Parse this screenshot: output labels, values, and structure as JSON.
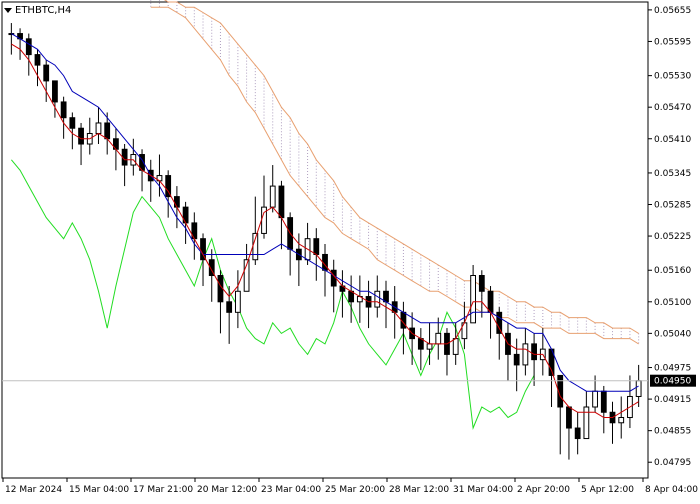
{
  "symbol_label": "ETHBTC,H4",
  "chart_data": {
    "type": "line",
    "title": "ETHBTC,H4",
    "ylim": [
      0.04765,
      0.0567
    ],
    "y_ticks": [
      "0.05655",
      "0.05595",
      "0.05530",
      "0.05470",
      "0.05410",
      "0.05345",
      "0.05285",
      "0.05225",
      "0.05160",
      "0.05100",
      "0.05040",
      "0.04975",
      "0.04915",
      "0.04855",
      "0.04795"
    ],
    "x_ticks": [
      "12 Mar 2024",
      "15 Mar 04:00",
      "17 Mar 21:00",
      "20 Mar 12:00",
      "23 Mar 04:00",
      "25 Mar 20:00",
      "28 Mar 12:00",
      "31 Mar 04:00",
      "2 Apr 20:00",
      "5 Apr 12:00",
      "8 Apr 04:00"
    ],
    "current_price": "0.04950",
    "colors": {
      "bull": "#000000",
      "bear": "#000000",
      "tenkan": "#cc0000",
      "kijun": "#0000b8",
      "chikou": "#22dd22",
      "kumo_up": "#e8a070",
      "kumo_down": "#b0a0c0",
      "grid": "#c0c0c0"
    },
    "close": [
      0.0561,
      0.056,
      0.0557,
      0.0555,
      0.0552,
      0.0548,
      0.0545,
      0.0543,
      0.054,
      0.0542,
      0.0544,
      0.0541,
      0.0539,
      0.0536,
      0.0538,
      0.0535,
      0.0533,
      0.0534,
      0.053,
      0.0528,
      0.0525,
      0.0522,
      0.0518,
      0.0515,
      0.051,
      0.0508,
      0.0512,
      0.0518,
      0.0523,
      0.0528,
      0.0532,
      0.0526,
      0.052,
      0.0518,
      0.0522,
      0.0519,
      0.0516,
      0.0513,
      0.0512,
      0.051,
      0.0511,
      0.0509,
      0.0512,
      0.051,
      0.0508,
      0.0505,
      0.0503,
      0.0501,
      0.0502,
      0.0504,
      0.05,
      0.0503,
      0.0506,
      0.0515,
      0.0512,
      0.0508,
      0.0504,
      0.05,
      0.0498,
      0.0502,
      0.0499,
      0.0501,
      0.0496,
      0.049,
      0.0486,
      0.0484,
      0.049,
      0.0493,
      0.0489,
      0.0487,
      0.0488,
      0.0492,
      0.0495
    ],
    "high": [
      0.0563,
      0.0562,
      0.0561,
      0.0558,
      0.0556,
      0.0552,
      0.0549,
      0.0546,
      0.0544,
      0.0545,
      0.0547,
      0.0546,
      0.0543,
      0.054,
      0.0541,
      0.0539,
      0.0537,
      0.0538,
      0.0535,
      0.0532,
      0.0529,
      0.0527,
      0.0523,
      0.052,
      0.0516,
      0.0513,
      0.0516,
      0.0521,
      0.053,
      0.0534,
      0.0536,
      0.0533,
      0.0527,
      0.0523,
      0.0525,
      0.0524,
      0.0521,
      0.0518,
      0.0516,
      0.0515,
      0.0515,
      0.0514,
      0.0515,
      0.0514,
      0.0513,
      0.051,
      0.0508,
      0.0505,
      0.0506,
      0.0507,
      0.0505,
      0.0506,
      0.051,
      0.0517,
      0.0516,
      0.0513,
      0.0509,
      0.0506,
      0.0503,
      0.0505,
      0.0504,
      0.0505,
      0.0501,
      0.0496,
      0.049,
      0.0489,
      0.0493,
      0.0496,
      0.0494,
      0.0491,
      0.0492,
      0.0496,
      0.0498
    ],
    "low": [
      0.0557,
      0.0556,
      0.0553,
      0.0551,
      0.0548,
      0.0545,
      0.0541,
      0.0539,
      0.0536,
      0.0538,
      0.054,
      0.0538,
      0.0535,
      0.0532,
      0.0534,
      0.0531,
      0.0529,
      0.053,
      0.0526,
      0.0524,
      0.0521,
      0.0518,
      0.0513,
      0.051,
      0.0504,
      0.0502,
      0.0505,
      0.0512,
      0.0517,
      0.0522,
      0.0527,
      0.052,
      0.0515,
      0.0513,
      0.0517,
      0.0514,
      0.0511,
      0.0508,
      0.0507,
      0.0506,
      0.0506,
      0.0505,
      0.0507,
      0.0505,
      0.0503,
      0.05,
      0.0498,
      0.0497,
      0.0498,
      0.0499,
      0.0496,
      0.0498,
      0.0501,
      0.0509,
      0.0507,
      0.0503,
      0.0499,
      0.0495,
      0.0493,
      0.0496,
      0.0494,
      0.0496,
      0.049,
      0.0481,
      0.048,
      0.0481,
      0.0485,
      0.0489,
      0.0485,
      0.0483,
      0.0484,
      0.0486,
      0.049
    ],
    "tenkan": [
      0.0559,
      0.0558,
      0.0556,
      0.0553,
      0.055,
      0.0547,
      0.0544,
      0.0542,
      0.0541,
      0.0541,
      0.0542,
      0.0541,
      0.0539,
      0.0537,
      0.0537,
      0.0535,
      0.0534,
      0.0533,
      0.0531,
      0.0528,
      0.0525,
      0.0522,
      0.0519,
      0.0516,
      0.0513,
      0.0511,
      0.0513,
      0.0517,
      0.0522,
      0.0527,
      0.0528,
      0.0526,
      0.0523,
      0.0521,
      0.052,
      0.0519,
      0.0517,
      0.0515,
      0.0513,
      0.0512,
      0.0511,
      0.051,
      0.051,
      0.0509,
      0.0508,
      0.0506,
      0.0504,
      0.0503,
      0.0502,
      0.0502,
      0.0502,
      0.0503,
      0.0506,
      0.051,
      0.051,
      0.0508,
      0.0505,
      0.0502,
      0.0501,
      0.0501,
      0.05,
      0.05,
      0.0497,
      0.0492,
      0.049,
      0.0489,
      0.0489,
      0.0489,
      0.0488,
      0.0488,
      0.0489,
      0.049,
      0.0491
    ],
    "kijun": [
      0.0561,
      0.056,
      0.0559,
      0.0558,
      0.0556,
      0.0555,
      0.0553,
      0.055,
      0.0549,
      0.0548,
      0.0547,
      0.0545,
      0.0543,
      0.0541,
      0.0539,
      0.0537,
      0.0534,
      0.0532,
      0.0529,
      0.0526,
      0.0524,
      0.0521,
      0.0519,
      0.0519,
      0.0519,
      0.0519,
      0.0519,
      0.0519,
      0.0519,
      0.0519,
      0.052,
      0.0521,
      0.052,
      0.0519,
      0.0518,
      0.0517,
      0.0516,
      0.0515,
      0.0514,
      0.0513,
      0.0512,
      0.0512,
      0.0511,
      0.051,
      0.0509,
      0.0508,
      0.0507,
      0.0506,
      0.0506,
      0.0506,
      0.0506,
      0.0506,
      0.0507,
      0.0508,
      0.0508,
      0.0508,
      0.0507,
      0.0506,
      0.0505,
      0.0505,
      0.0504,
      0.0504,
      0.0501,
      0.0497,
      0.0495,
      0.0494,
      0.0493,
      0.0493,
      0.0493,
      0.0493,
      0.0493,
      0.0493,
      0.0494
    ],
    "chikou": [
      0.0537,
      0.0535,
      0.0532,
      0.0529,
      0.0526,
      0.0524,
      0.0522,
      0.0525,
      0.0522,
      0.0518,
      0.0512,
      0.0505,
      0.0513,
      0.052,
      0.0527,
      0.053,
      0.0528,
      0.0526,
      0.0522,
      0.0519,
      0.0516,
      0.0513,
      0.0518,
      0.0522,
      0.0516,
      0.0512,
      0.0509,
      0.0505,
      0.0503,
      0.0502,
      0.0506,
      0.0504,
      0.0505,
      0.0502,
      0.05,
      0.0503,
      0.0502,
      0.0506,
      0.0512,
      0.0509,
      0.0505,
      0.0502,
      0.05,
      0.0498,
      0.0501,
      0.0504,
      0.05,
      0.0496,
      0.05,
      0.0503,
      0.0508,
      0.0505,
      0.05,
      0.0486,
      0.049,
      0.0489,
      0.049,
      0.0488,
      0.0489,
      0.0493,
      0.0496
    ],
    "span_a": [
      0.0566,
      0.0566,
      0.0566,
      0.0565,
      0.0564,
      0.0562,
      0.056,
      0.0558,
      0.0556,
      0.0553,
      0.0551,
      0.0548,
      0.0546,
      0.0543,
      0.054,
      0.0537,
      0.0534,
      0.0532,
      0.053,
      0.0528,
      0.0526,
      0.0525,
      0.0523,
      0.0522,
      0.0521,
      0.052,
      0.0518,
      0.0517,
      0.0516,
      0.0515,
      0.0514,
      0.0513,
      0.0512,
      0.0512,
      0.0511,
      0.051,
      0.0509,
      0.0509,
      0.0508,
      0.0508,
      0.0507,
      0.0507,
      0.0506,
      0.0506,
      0.0506,
      0.0505,
      0.0505,
      0.0505,
      0.0504,
      0.0504,
      0.0504,
      0.0504,
      0.0503,
      0.0503,
      0.0503,
      0.0503,
      0.0502
    ],
    "span_b": [
      0.0568,
      0.0568,
      0.0567,
      0.0567,
      0.0566,
      0.0566,
      0.0565,
      0.0564,
      0.0563,
      0.0561,
      0.0559,
      0.0557,
      0.0555,
      0.0553,
      0.055,
      0.0547,
      0.0545,
      0.0542,
      0.054,
      0.0537,
      0.0535,
      0.0533,
      0.053,
      0.0528,
      0.0526,
      0.0525,
      0.0524,
      0.0523,
      0.0522,
      0.0521,
      0.052,
      0.0519,
      0.0518,
      0.0517,
      0.0516,
      0.0515,
      0.0514,
      0.0514,
      0.0513,
      0.0512,
      0.0512,
      0.0511,
      0.051,
      0.051,
      0.0509,
      0.0509,
      0.0508,
      0.0508,
      0.0507,
      0.0507,
      0.0507,
      0.0506,
      0.0506,
      0.0505,
      0.0505,
      0.0505,
      0.0504
    ]
  }
}
